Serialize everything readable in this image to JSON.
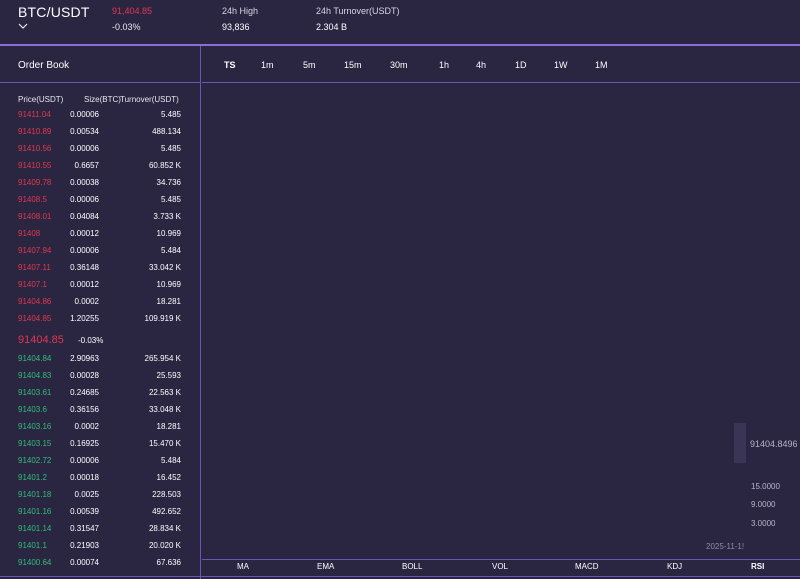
{
  "header": {
    "pair": "BTC/USDT",
    "last_price": "91,404.85",
    "change": "-0.03%",
    "high_label": "24h High",
    "high_value": "93,836",
    "turnover_label": "24h Turnover(USDT)",
    "turnover_value": "2.304 B",
    "chevron_icon": "chevron-down-icon"
  },
  "orderbook": {
    "title": "Order Book",
    "columns": [
      "Price(USDT)",
      "Size(BTC)",
      "Turnover(USDT)"
    ],
    "asks": [
      {
        "price": "91411.04",
        "size": "0.00006",
        "turnover": "5.485"
      },
      {
        "price": "91410.89",
        "size": "0.00534",
        "turnover": "488.134"
      },
      {
        "price": "91410.56",
        "size": "0.00006",
        "turnover": "5.485"
      },
      {
        "price": "91410.55",
        "size": "0.6657",
        "turnover": "60.852 K"
      },
      {
        "price": "91409.78",
        "size": "0.00038",
        "turnover": "34.736"
      },
      {
        "price": "91408.5",
        "size": "0.00006",
        "turnover": "5.485"
      },
      {
        "price": "91408.01",
        "size": "0.04084",
        "turnover": "3.733 K"
      },
      {
        "price": "91408",
        "size": "0.00012",
        "turnover": "10.969"
      },
      {
        "price": "91407.94",
        "size": "0.00006",
        "turnover": "5.484"
      },
      {
        "price": "91407.11",
        "size": "0.36148",
        "turnover": "33.042 K"
      },
      {
        "price": "91407.1",
        "size": "0.00012",
        "turnover": "10.969"
      },
      {
        "price": "91404.86",
        "size": "0.0002",
        "turnover": "18.281"
      },
      {
        "price": "91404.85",
        "size": "1.20255",
        "turnover": "109.919 K"
      }
    ],
    "mid_price": "91404.85",
    "mid_change": "-0.03%",
    "bids": [
      {
        "price": "91404.84",
        "size": "2.90963",
        "turnover": "265.954 K"
      },
      {
        "price": "91404.83",
        "size": "0.00028",
        "turnover": "25.593"
      },
      {
        "price": "91403.61",
        "size": "0.24685",
        "turnover": "22.563 K"
      },
      {
        "price": "91403.6",
        "size": "0.36156",
        "turnover": "33.048 K"
      },
      {
        "price": "91403.16",
        "size": "0.0002",
        "turnover": "18.281"
      },
      {
        "price": "91403.15",
        "size": "0.16925",
        "turnover": "15.470 K"
      },
      {
        "price": "91402.72",
        "size": "0.00006",
        "turnover": "5.484"
      },
      {
        "price": "91401.2",
        "size": "0.00018",
        "turnover": "16.452"
      },
      {
        "price": "91401.18",
        "size": "0.0025",
        "turnover": "228.503"
      },
      {
        "price": "91401.16",
        "size": "0.00539",
        "turnover": "492.652"
      },
      {
        "price": "91401.14",
        "size": "0.31547",
        "turnover": "28.834 K"
      },
      {
        "price": "91401.1",
        "size": "0.21903",
        "turnover": "20.020 K"
      },
      {
        "price": "91400.64",
        "size": "0.00074",
        "turnover": "67.636"
      }
    ]
  },
  "chart": {
    "intervals": [
      "TS",
      "1m",
      "5m",
      "15m",
      "30m",
      "1h",
      "4h",
      "1D",
      "1W",
      "1M"
    ],
    "active_interval": "TS",
    "price_label": "91404.8496",
    "rsi_ticks": [
      "15.0000",
      "9.0000",
      "3.0000"
    ],
    "date_label": "2025-11-1!",
    "indicators": [
      "MA",
      "EMA",
      "BOLL",
      "VOL",
      "MACD",
      "KDJ",
      "RSI"
    ],
    "active_indicator": "RSI"
  },
  "colors": {
    "background": "#2a2541",
    "ask": "#e0384f",
    "bid": "#2fbe7a",
    "accent": "#8a6fd6"
  }
}
